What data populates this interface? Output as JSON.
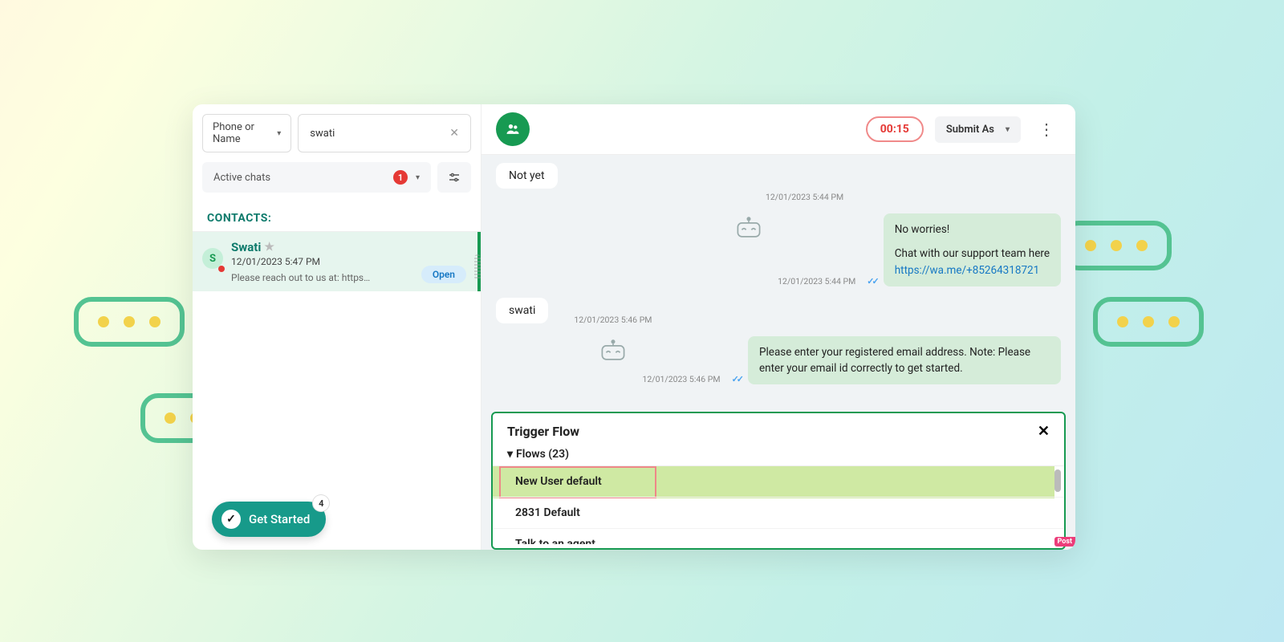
{
  "sidebar": {
    "filter_label": "Phone or Name",
    "search_value": "swati",
    "active_chats_label": "Active chats",
    "active_chats_badge": "1",
    "contacts_header": "CONTACTS:",
    "contact": {
      "initial": "S",
      "name": "Swati",
      "timestamp": "12/01/2023 5:47 PM",
      "preview": "Please reach out to us at: https…",
      "open_label": "Open"
    },
    "get_started": {
      "label": "Get Started",
      "count": "4"
    }
  },
  "chat": {
    "timer": "00:15",
    "submit_as_label": "Submit As",
    "messages": {
      "m1_text": "Not yet",
      "m1_ts": "12/01/2023 5:44 PM",
      "m2_ts": "12/01/2023 5:44 PM",
      "m2_line1": "No worries!",
      "m2_line2": "Chat with our support team here",
      "m2_link": "https://wa.me/+85264318721",
      "m3_text": "swati",
      "m3_ts": "12/01/2023 5:46 PM",
      "m4_ts": "12/01/2023 5:46 PM",
      "m4_line1": "Please enter your registered email address.",
      "m4_line2": "Note: Please enter your email id correctly to get started."
    },
    "trigger": {
      "title": "Trigger Flow",
      "flows_label": "Flows (23)",
      "items": {
        "0": "New User default",
        "1": "2831 Default",
        "2": "Talk to an agent"
      }
    }
  }
}
